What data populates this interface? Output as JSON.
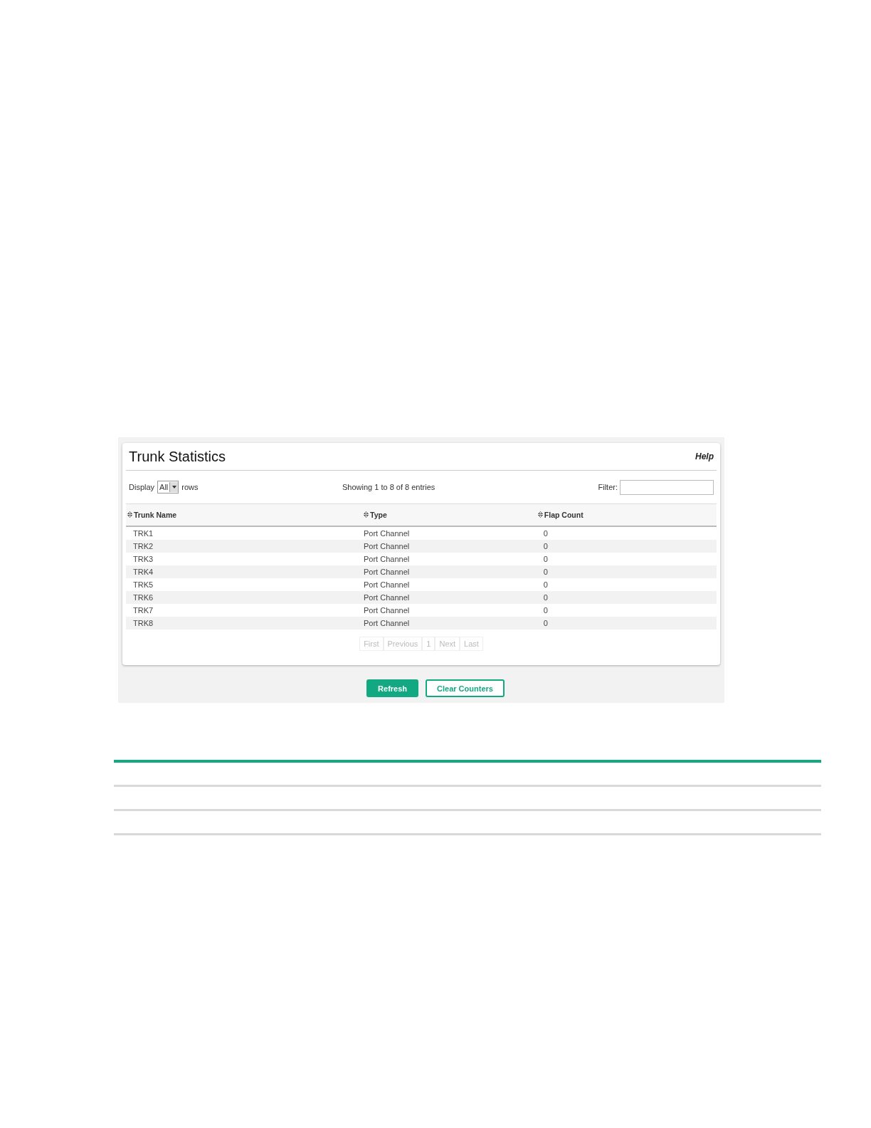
{
  "panel": {
    "title": "Trunk Statistics",
    "help": "Help",
    "display": {
      "label": "Display",
      "value": "All",
      "suffix": "rows"
    },
    "info": "Showing 1 to 8 of 8 entries",
    "filter": {
      "label": "Filter:"
    },
    "table": {
      "columns": [
        "Trunk Name",
        "Type",
        "Flap Count"
      ],
      "rows": [
        [
          "TRK1",
          "Port Channel",
          "0"
        ],
        [
          "TRK2",
          "Port Channel",
          "0"
        ],
        [
          "TRK3",
          "Port Channel",
          "0"
        ],
        [
          "TRK4",
          "Port Channel",
          "0"
        ],
        [
          "TRK5",
          "Port Channel",
          "0"
        ],
        [
          "TRK6",
          "Port Channel",
          "0"
        ],
        [
          "TRK7",
          "Port Channel",
          "0"
        ],
        [
          "TRK8",
          "Port Channel",
          "0"
        ]
      ]
    },
    "pagination": [
      {
        "label": "First",
        "disabled": true
      },
      {
        "label": "Previous",
        "disabled": true
      },
      {
        "label": "1",
        "disabled": true
      },
      {
        "label": "Next",
        "disabled": true
      },
      {
        "label": "Last",
        "disabled": true
      }
    ],
    "buttons": [
      {
        "label": "Refresh",
        "kind": "primary"
      },
      {
        "label": "Clear Counters",
        "kind": "secondary"
      }
    ]
  }
}
